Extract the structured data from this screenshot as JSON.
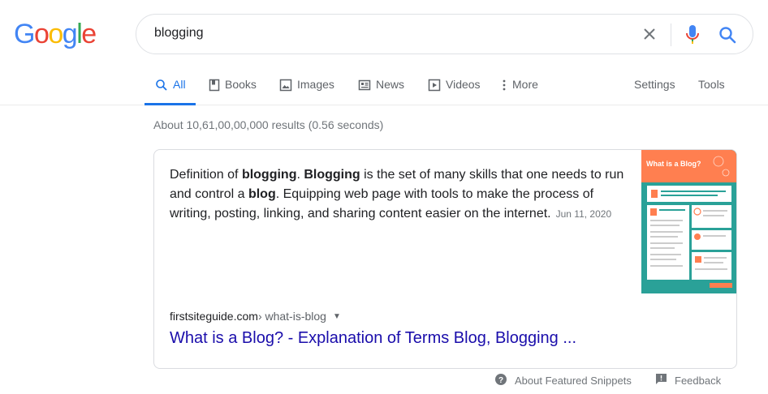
{
  "logo": {
    "letters": [
      "G",
      "o",
      "o",
      "g",
      "l",
      "e"
    ],
    "colors": [
      "#4285f4",
      "#ea4335",
      "#fbbc05",
      "#4285f4",
      "#34a853",
      "#ea4335"
    ]
  },
  "search": {
    "query": "blogging",
    "clear_icon": "close-icon",
    "mic_icon": "microphone-icon",
    "search_icon": "search-icon"
  },
  "tabs": [
    {
      "label": "All",
      "icon": "search-icon",
      "active": true
    },
    {
      "label": "Books",
      "icon": "book-icon"
    },
    {
      "label": "Images",
      "icon": "image-icon"
    },
    {
      "label": "News",
      "icon": "newspaper-icon"
    },
    {
      "label": "Videos",
      "icon": "video-icon"
    },
    {
      "label": "More",
      "icon": "more-vert-icon"
    }
  ],
  "tools": {
    "settings": "Settings",
    "tools": "Tools"
  },
  "stats": "About 10,61,00,00,000 results (0.56 seconds)",
  "featured_snippet": {
    "text_parts": [
      {
        "t": "Definition of ",
        "b": false
      },
      {
        "t": "blogging",
        "b": true
      },
      {
        "t": ". ",
        "b": false
      },
      {
        "t": "Blogging",
        "b": true
      },
      {
        "t": " is the set of many skills that one needs to run and control a ",
        "b": false
      },
      {
        "t": "blog",
        "b": true
      },
      {
        "t": ". Equipping web page with tools to make the process of writing, posting, linking, and sharing content easier on the internet.",
        "b": false
      }
    ],
    "date": "Jun 11, 2020",
    "thumbnail_heading": "What is a Blog?",
    "source_domain": "firstsiteguide.com",
    "source_path": " › what-is-blog",
    "title": "What is a Blog? - Explanation of Terms Blog, Blogging ..."
  },
  "footer": {
    "about": "About Featured Snippets",
    "feedback": "Feedback"
  },
  "colors": {
    "accent": "#1a73e8",
    "link": "#1a0dab",
    "muted": "#70757a",
    "thumb_bg": "#2aa198",
    "thumb_accent": "#ff7f50"
  }
}
